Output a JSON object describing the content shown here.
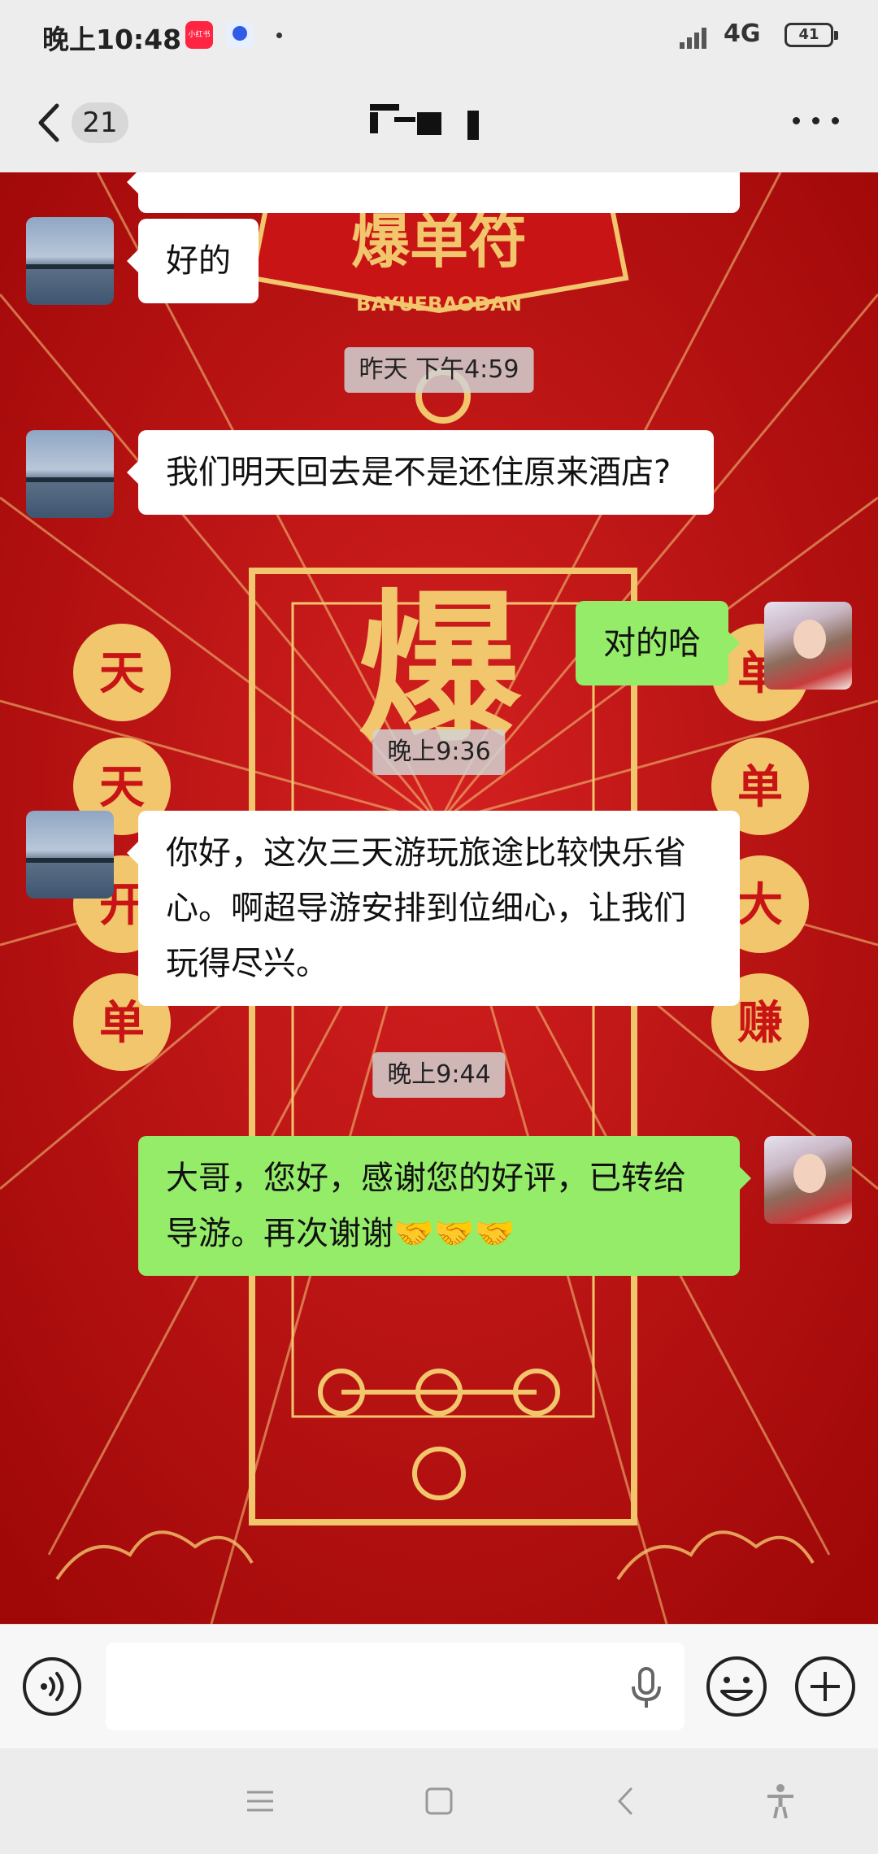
{
  "status_bar": {
    "time": "晚上10:48",
    "app_badge_1": "小红书",
    "network": "4G",
    "battery": "41"
  },
  "header": {
    "unread_count": "21"
  },
  "messages": [
    {
      "side": "left",
      "text": "好的"
    },
    {
      "timestamp": "昨天 下午4:59"
    },
    {
      "side": "left",
      "text": "我们明天回去是不是还住原来酒店?"
    },
    {
      "side": "right",
      "text": "对的哈"
    },
    {
      "timestamp": "晚上9:36"
    },
    {
      "side": "left",
      "text": "你好，这次三天游玩旅途比较快乐省心。啊超导游安排到位细心，让我们玩得尽兴。"
    },
    {
      "timestamp": "晚上9:44"
    },
    {
      "side": "right",
      "text": "大哥，您好，感谢您的好评，已转给导游。再次谢谢🤝🤝🤝"
    }
  ],
  "wallpaper": {
    "banner_text": "爆单符",
    "banner_subtitle": "BAYUEBAODAN",
    "left_circles": [
      "天",
      "天",
      "开",
      "单"
    ],
    "right_circles": [
      "单",
      "单",
      "大",
      "赚"
    ],
    "center_text": "爆",
    "colors": {
      "red": "#b80d0d",
      "gold": "#f2c66d"
    }
  },
  "input": {
    "placeholder": ""
  },
  "theme": {
    "bubble_right": "#95ec69",
    "bubble_left": "#ffffff"
  }
}
